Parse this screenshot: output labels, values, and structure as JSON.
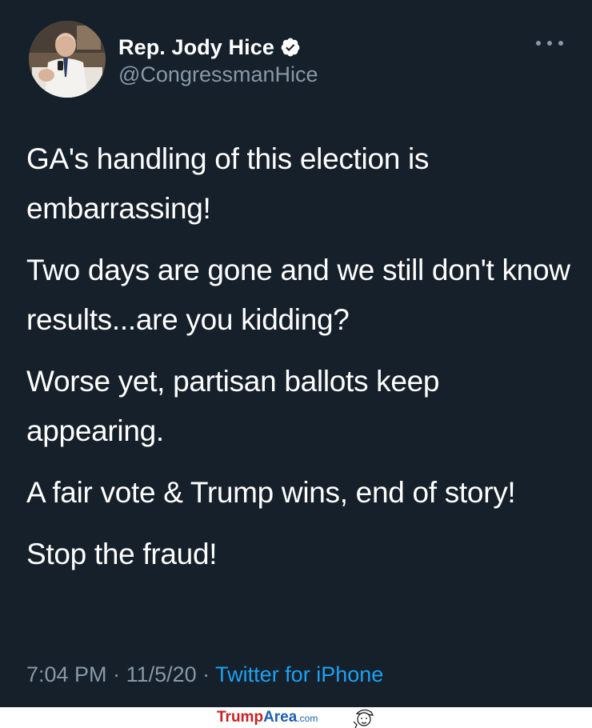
{
  "user": {
    "display_name": "Rep. Jody Hice",
    "handle": "@CongressmanHice",
    "verified": true,
    "avatar_icon": "profile-photo"
  },
  "header": {
    "more_icon": "more-dots-icon"
  },
  "tweet": {
    "paragraphs": [
      "GA's handling of this election is embarrassing!",
      "Two days are gone and we still don't know results...are you kidding?",
      "Worse yet, partisan ballots keep appearing.",
      "A fair vote & Trump wins, end of story!",
      "Stop the fraud!"
    ]
  },
  "meta": {
    "time": "7:04 PM",
    "sep1": " · ",
    "date": "11/5/20",
    "sep2": " · ",
    "source": "Twitter for iPhone"
  },
  "watermark": {
    "part1": "Trump",
    "part2": "Area",
    "part3": ".com"
  },
  "colors": {
    "background": "#15202b",
    "text": "#ffffff",
    "secondary": "#8899a6",
    "accent": "#1da1f2"
  }
}
